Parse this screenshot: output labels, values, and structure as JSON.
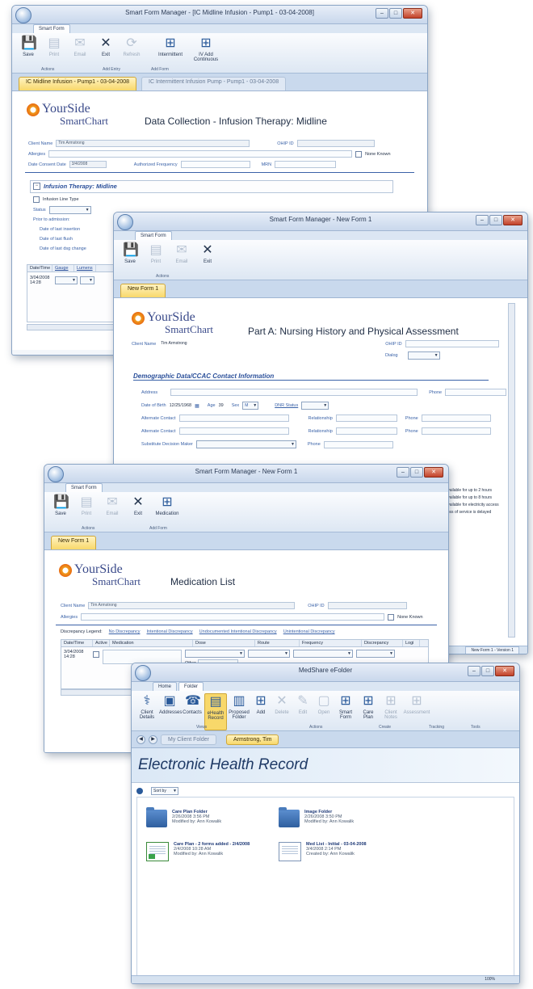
{
  "win1": {
    "title": "Smart Form Manager - [IC Midline Infusion - Pump1 - 03-04-2008]",
    "ribbon_tab": "Smart Form",
    "buttons": [
      "Save",
      "Print",
      "Email",
      "Exit",
      "Refresh",
      "Intermittent",
      "IV Add Continuous"
    ],
    "groups": [
      "Actions",
      "Add Entry",
      "Add Form"
    ],
    "doc_tabs": [
      "IC Midline Infusion - Pump1 - 03-04-2008",
      "IC Intermittent Infusion Pump - Pump1 - 03-04-2008"
    ],
    "logo_top": "YourSide",
    "logo_bottom": "SmartChart",
    "form_title": "Data Collection - Infusion Therapy: Midline",
    "client_name_label": "Client Name",
    "client_name_value": "Tim Armstrong",
    "ohip_label": "OHIP ID",
    "allergies_label": "Allergies",
    "none_known": "None Known",
    "consent_label": "Date Consent Date",
    "consent_value": "3/4/2008",
    "freq_label": "Authorized Frequency",
    "mrn_label": "MRN",
    "section": "Infusion Therapy: Midline",
    "line_type": "Infusion Line Type",
    "status_label": "Status",
    "prior_admission": "Prior to admission:",
    "date_insertion": "Date of last insertion",
    "date_flush": "Date of last flush",
    "date_dressing": "Date of last dsg change",
    "grid_cols": [
      "Date/Time",
      "Gauge",
      "Lumens"
    ],
    "grid_value": "3/04/2008 14:28"
  },
  "win2": {
    "title": "Smart Form Manager - New Form 1",
    "ribbon_tab": "Smart Form",
    "buttons": [
      "Save",
      "Print",
      "Email",
      "Exit"
    ],
    "group": "Actions",
    "doc_tab": "New Form 1",
    "form_title": "Part A: Nursing History and Physical Assessment",
    "client_name_label": "Client Name",
    "client_name_value": "Tim Armstrong",
    "ohip_label": "OHIP ID",
    "dialog_label": "Dialog",
    "section": "Demographic Data/CCAC Contact Information",
    "address_label": "Address",
    "phone_label": "Phone",
    "dob_label": "Date of Birth",
    "dob_value": "12/25/1968",
    "age_label": "Age",
    "age_value": "39",
    "sex_label": "Sex",
    "sex_value": "M",
    "dnr_label": "DNR Status",
    "alt_contact_label": "Alternate Contact",
    "relationship_label": "Relationship",
    "substitute_label": "Substitute Decision Maker",
    "right_notes": [
      "Available for up to 2 hours",
      "Available for up to 8 hours",
      "Available for electricity access",
      "Loss of service is delayed"
    ],
    "status_tab": "New Form 1 - Version 1"
  },
  "win3": {
    "title": "Smart Form Manager - New Form 1",
    "ribbon_tab": "Smart Form",
    "buttons": [
      "Save",
      "Print",
      "Email",
      "Exit",
      "Medication"
    ],
    "groups": [
      "Actions",
      "Add Form"
    ],
    "doc_tab": "New Form 1",
    "form_title": "Medication List",
    "client_name_label": "Client Name",
    "client_name_value": "Tim Armstrong",
    "ohip_label": "OHIP ID",
    "allergies_label": "Allergies",
    "none_known": "None Known",
    "legend": [
      "Discrepancy Legend:",
      "No Discrepancy",
      "Intentional Discrepancy",
      "Undocumented Intentional Discrepancy",
      "Unintentional Discrepancy"
    ],
    "grid_cols": [
      "Date/Time",
      "Active",
      "Medication",
      "Dose",
      "Route",
      "Frequency",
      "Discrepancy",
      "Logi"
    ],
    "row_date": "3/04/2008 14:28",
    "row_other": "Other"
  },
  "win4": {
    "title": "MedShare eFolder",
    "ribbon_tabs": [
      "Home",
      "Folder"
    ],
    "buttons": [
      "Client Details",
      "Addresses",
      "Contacts",
      "eHealth Record",
      "Proposed Folder",
      "Add",
      "Delete",
      "Edit",
      "Open",
      "Smart Form",
      "Care Plan",
      "Client Notes",
      "Assessment"
    ],
    "groups": [
      "Views",
      "Actions",
      "Create",
      "Tracking",
      "Tools"
    ],
    "tabs": [
      "My Client Folder",
      "Armstrong, Tim"
    ],
    "heading": "Electronic Health Record",
    "sort_label": "Sort by",
    "items": [
      {
        "name": "Care Plan Folder",
        "date": "2/26/2008 3:56 PM",
        "by": "Modified by: Ann Kowalik"
      },
      {
        "name": "Image Folder",
        "date": "2/26/2008 3:50 PM",
        "by": "Modified by: Ann Kowalik"
      },
      {
        "name": "Care Plan - 2 forms added - 2/4/2008",
        "date": "2/4/2008 10:28 AM",
        "by": "Modified by: Ann Kowalik"
      },
      {
        "name": "Med List - Initial - 03-04-2008",
        "date": "3/4/2008 2:14 PM",
        "by": "Created by: Ann Kowalik"
      }
    ],
    "status_right": "100%"
  }
}
